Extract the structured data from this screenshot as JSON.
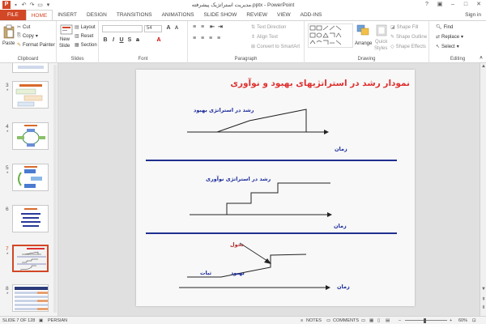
{
  "window": {
    "title": "مدیریت استراتژیک پیشرفته.pptx - PowerPoint",
    "app_badge": "P",
    "signin": "Sign in"
  },
  "tabs": [
    {
      "label": "FILE"
    },
    {
      "label": "HOME"
    },
    {
      "label": "INSERT"
    },
    {
      "label": "DESIGN"
    },
    {
      "label": "TRANSITIONS"
    },
    {
      "label": "ANIMATIONS"
    },
    {
      "label": "SLIDE SHOW"
    },
    {
      "label": "REVIEW"
    },
    {
      "label": "VIEW"
    },
    {
      "label": "ADD-INS"
    }
  ],
  "ribbon": {
    "clipboard": {
      "paste": "Paste",
      "cut": "Cut",
      "copy": "Copy",
      "format_painter": "Format Painter",
      "label": "Clipboard"
    },
    "slides": {
      "new_slide": "New",
      "new_slide2": "Slide",
      "layout": "Layout",
      "reset": "Reset",
      "section": "Section",
      "label": "Slides"
    },
    "font": {
      "size": "54",
      "label": "Font"
    },
    "paragraph": {
      "text_direction": "Text Direction",
      "align_text": "Align Text",
      "convert_smartart": "Convert to SmartArt",
      "label": "Paragraph"
    },
    "drawing": {
      "arrange": "Arrange",
      "quick_styles": "Quick",
      "quick_styles2": "Styles",
      "shape_fill": "Shape Fill",
      "shape_outline": "Shape Outline",
      "shape_effects": "Shape Effects",
      "label": "Drawing"
    },
    "editing": {
      "find": "Find",
      "replace": "Replace",
      "select": "Select",
      "label": "Editing"
    }
  },
  "thumbnails": [
    {
      "num": "3",
      "star": "*"
    },
    {
      "num": "4",
      "star": "*"
    },
    {
      "num": "5",
      "star": "*"
    },
    {
      "num": "6",
      "star": ""
    },
    {
      "num": "7",
      "star": "*"
    },
    {
      "num": "8",
      "star": "*"
    }
  ],
  "slide": {
    "title": "نمودار رشد در استراتژیهای بهبود و نوآوری",
    "chart1": {
      "label": "رشد در استراتژی بهبود",
      "axis": "زمان"
    },
    "chart2": {
      "label": "رشد در استراتژی نوآوری",
      "axis": "زمان"
    },
    "chart3": {
      "transform": "تحول",
      "improve": "بهبود",
      "stability": "ثبات",
      "axis": "زمان"
    }
  },
  "status": {
    "slide_of": "SLIDE 7 OF 128",
    "language": "PERSIAN",
    "notes": "NOTES",
    "comments": "COMMENTS",
    "zoom": "60%"
  },
  "colors": {
    "accent": "#d24726",
    "title_red": "#e03030",
    "label_blue": "#1a2a9a",
    "divider_blue": "#1f2f8f"
  }
}
